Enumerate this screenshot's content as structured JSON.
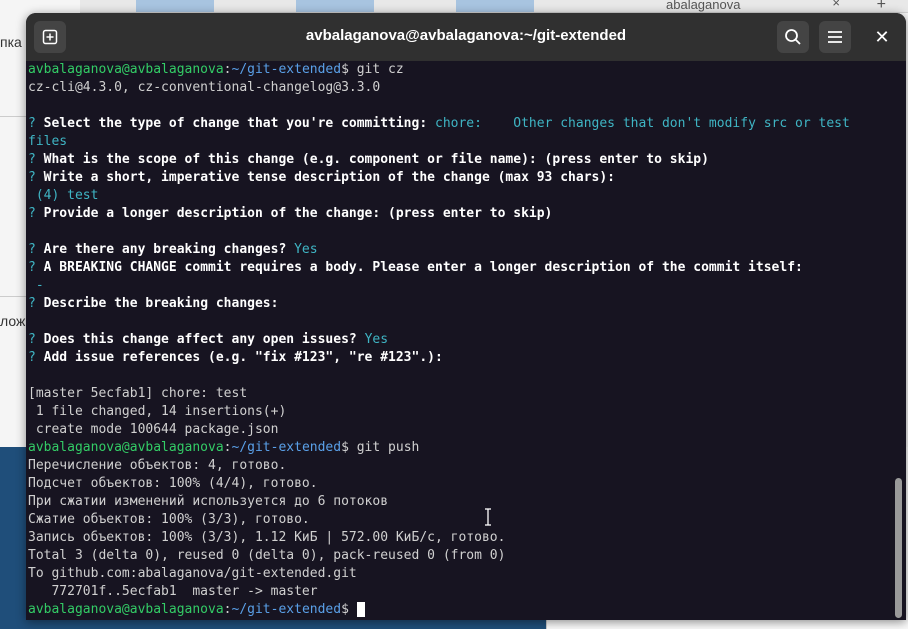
{
  "background": {
    "browser_tab_title": "abalaganova",
    "browser_tab_close": "×",
    "browser_new_tab": "+",
    "side_texts": [
      "пка",
      "лож"
    ]
  },
  "terminal": {
    "title": "avbalaganova@avbalaganova:~/git-extended",
    "close_glyph": "✕"
  },
  "prompt": {
    "user_host": "avbalaganova@avbalaganova",
    "sep": ":",
    "path": "~/git-extended",
    "dollar": "$"
  },
  "output": {
    "cmd1": " git cz",
    "l_version": "cz-cli@4.3.0, cz-conventional-changelog@3.3.0",
    "q_mark": "?",
    "q_type": " Select the type of change that you're committing: ",
    "a_type": "chore:    Other changes that don't modify src or test",
    "a_type_wrap": "files",
    "q_scope": " What is the scope of this change (e.g. component or file name): (press enter to skip)",
    "q_short": " Write a short, imperative tense description of the change (max 93 chars):",
    "a_short": " (4) test",
    "q_long": " Provide a longer description of the change: (press enter to skip)",
    "q_breaking": " Are there any breaking changes? ",
    "a_breaking": "Yes",
    "q_body": " A BREAKING CHANGE commit requires a body. Please enter a longer description of the commit itself:",
    "a_body": " -",
    "q_describe": " Describe the breaking changes:",
    "q_issues": " Does this change affect any open issues? ",
    "a_issues": "Yes",
    "q_refs": " Add issue references (e.g. \"fix #123\", \"re #123\".):",
    "commit_1": "[master 5ecfab1] chore: test",
    "commit_2": " 1 file changed, 14 insertions(+)",
    "commit_3": " create mode 100644 package.json",
    "cmd2": " git push",
    "push_1": "Перечисление объектов: 4, готово.",
    "push_2": "Подсчет объектов: 100% (4/4), готово.",
    "push_3": "При сжатии изменений используется до 6 потоков",
    "push_4": "Сжатие объектов: 100% (3/3), готово.",
    "push_5": "Запись объектов: 100% (3/3), 1.12 КиБ | 572.00 КиБ/с, готово.",
    "push_6": "Total 3 (delta 0), reused 0 (delta 0), pack-reused 0 (from 0)",
    "push_7": "To github.com:abalaganova/git-extended.git",
    "push_8": "   772701f..5ecfab1  master -> master"
  },
  "colors": {
    "terminal_bg": "#171421",
    "prompt_green": "#33cc66",
    "path_blue": "#5aa0e8",
    "answer_cyan": "#3fb5c4"
  }
}
